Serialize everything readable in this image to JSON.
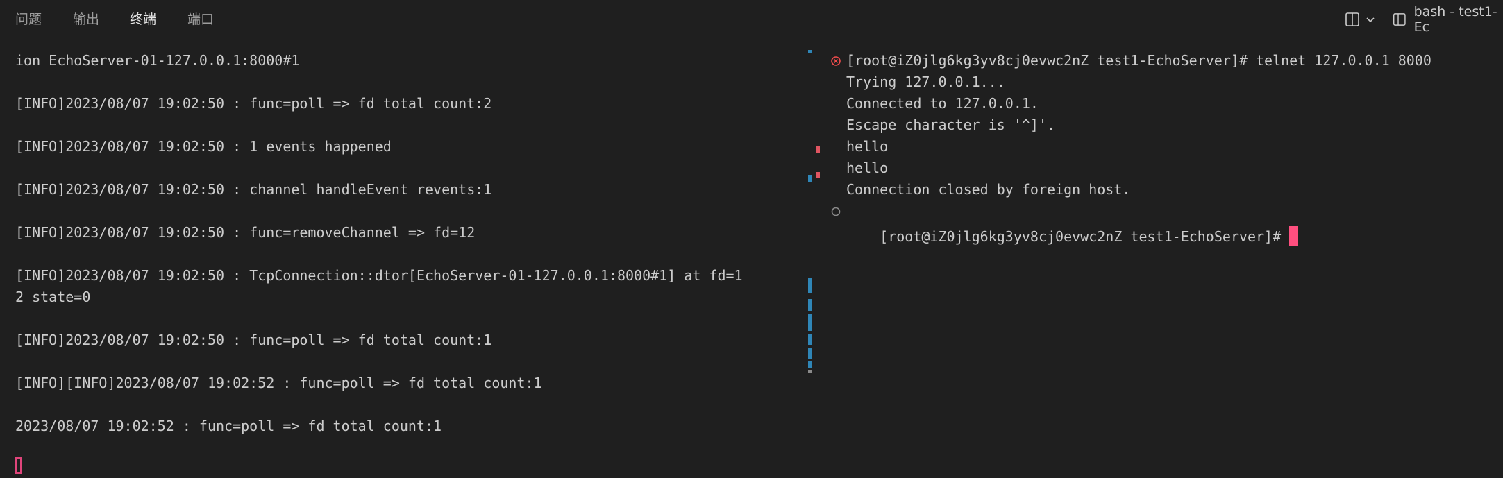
{
  "tabs": [
    {
      "label": "问题",
      "active": false
    },
    {
      "label": "输出",
      "active": false
    },
    {
      "label": "终端",
      "active": true
    },
    {
      "label": "端口",
      "active": false
    }
  ],
  "panel_actions": {
    "terminal_name": "bash - test1-Ec"
  },
  "left_terminal": {
    "lines": [
      "ion EchoServer-01-127.0.0.1:8000#1",
      "[INFO]2023/08/07 19:02:50 : func=poll => fd total count:2",
      "[INFO]2023/08/07 19:02:50 : 1 events happened",
      "[INFO]2023/08/07 19:02:50 : channel handleEvent revents:1",
      "[INFO]2023/08/07 19:02:50 : func=removeChannel => fd=12",
      "[INFO]2023/08/07 19:02:50 : TcpConnection::dtor[EchoServer-01-127.0.0.1:8000#1] at fd=1",
      "2 state=0",
      "[INFO]2023/08/07 19:02:50 : func=poll => fd total count:1",
      "[INFO][INFO]2023/08/07 19:02:52 : func=poll => fd total count:1",
      "2023/08/07 19:02:52 : func=poll => fd total count:1"
    ]
  },
  "right_terminal": {
    "lines": [
      "[root@iZ0jlg6kg3yv8cj0evwc2nZ test1-EchoServer]# telnet 127.0.0.1 8000",
      "Trying 127.0.0.1...",
      "Connected to 127.0.0.1.",
      "Escape character is '^]'.",
      "hello",
      "hello",
      "Connection closed by foreign host.",
      "[root@iZ0jlg6kg3yv8cj0evwc2nZ test1-EchoServer]# "
    ]
  },
  "colors": {
    "background": "#1f1f1f",
    "text": "#cccccc",
    "error_marker": "#f14c4c",
    "cursor": "#ff4f7f",
    "scroll_blue": "#2f86b7",
    "scroll_red": "#e05561"
  }
}
